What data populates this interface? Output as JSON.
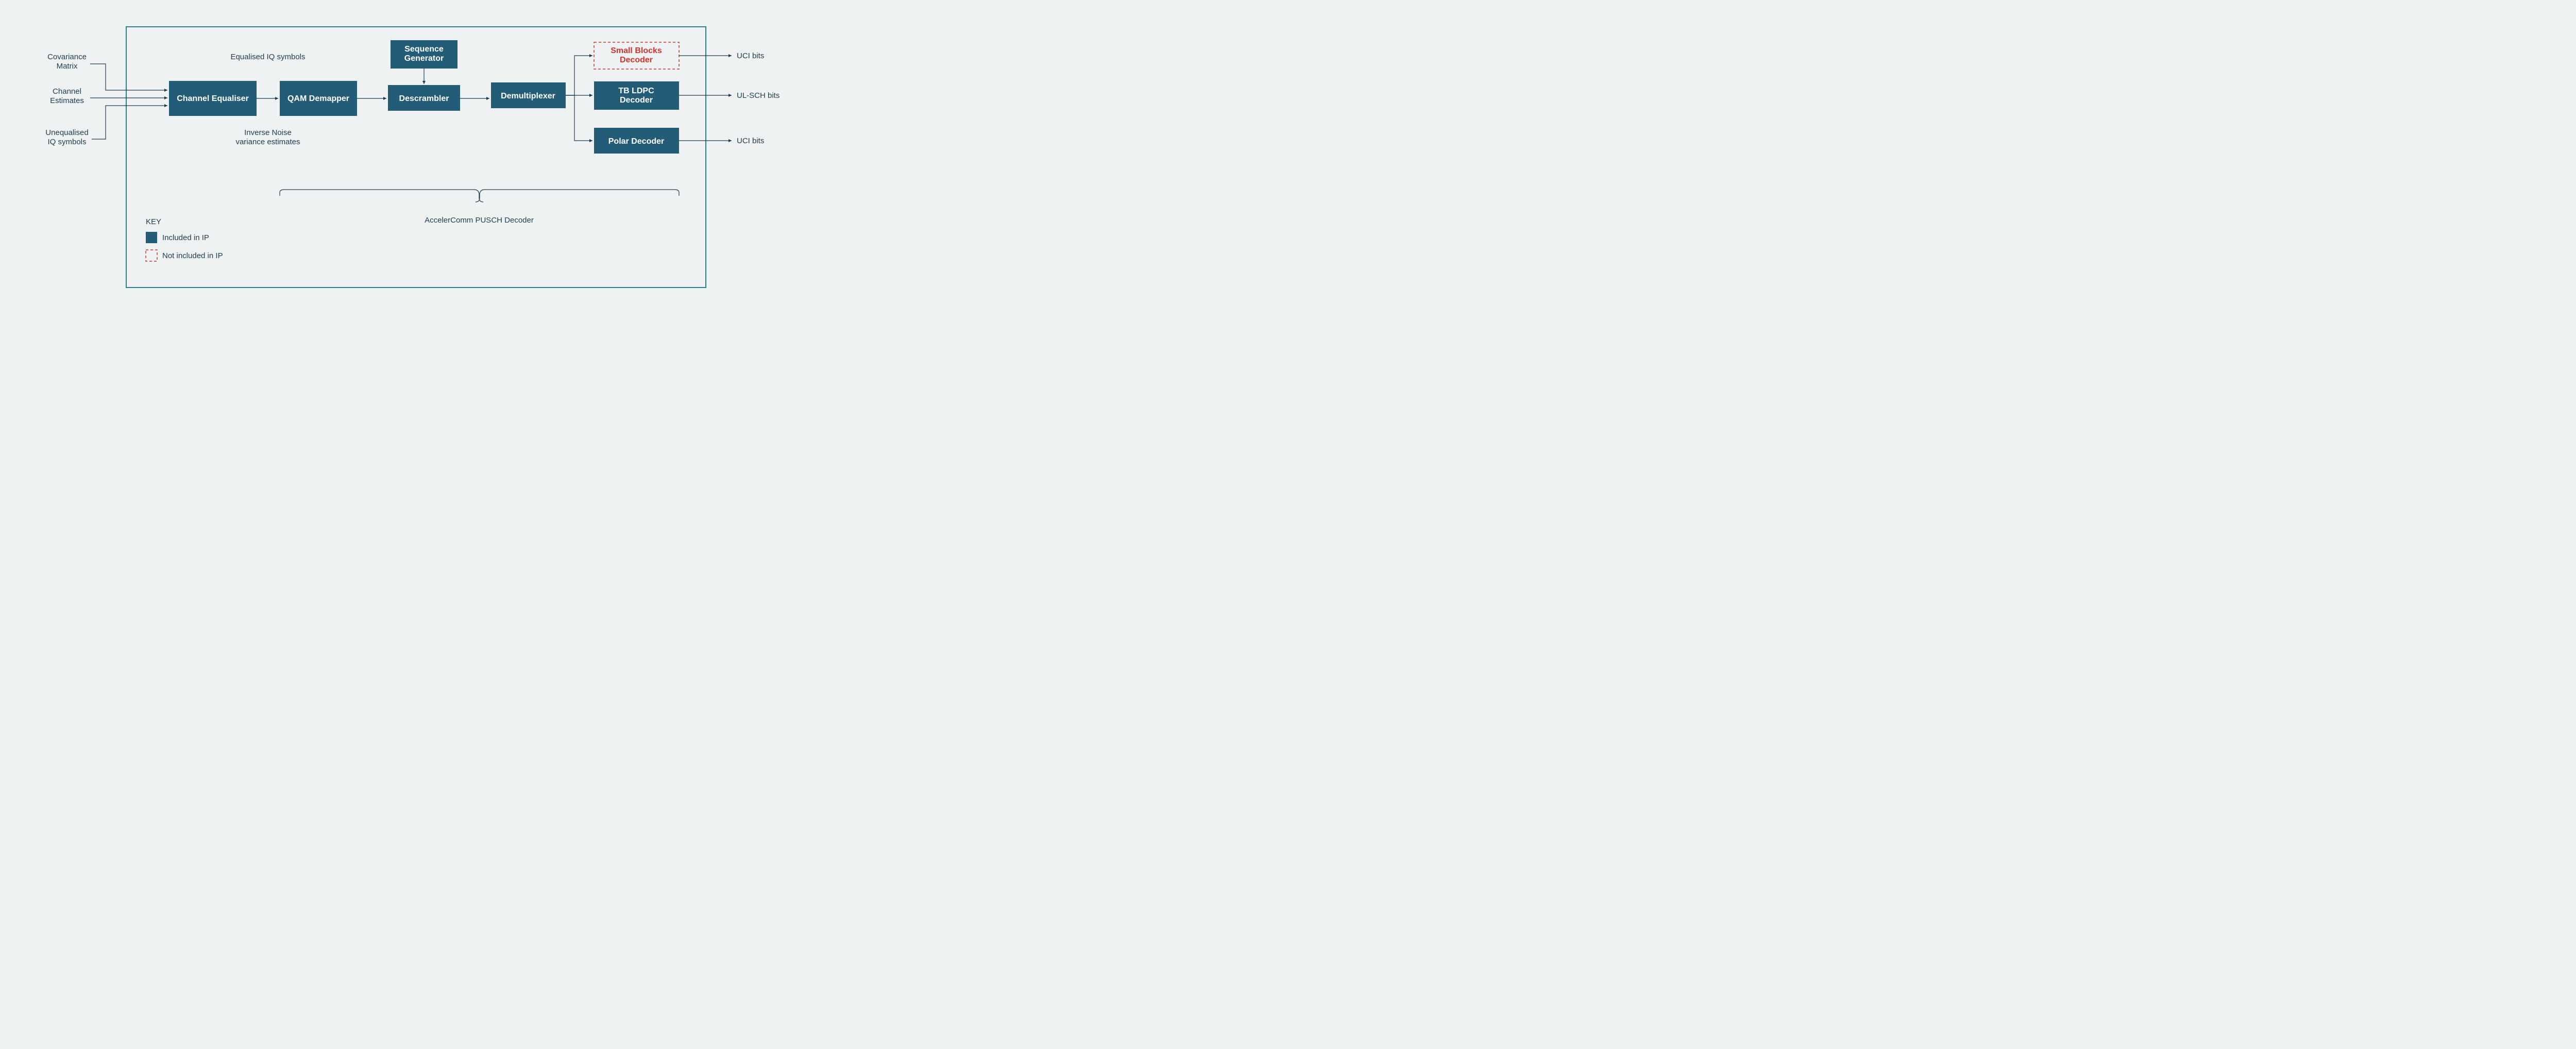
{
  "inputs": {
    "covariance": "Covariance\nMatrix",
    "channel_est": "Channel\nEstimates",
    "unequalised": "Unequalised\nIQ symbols"
  },
  "blocks": {
    "equaliser": "Channel Equaliser",
    "demapper": "QAM Demapper",
    "seqgen": "Sequence\nGenerator",
    "descrambler": "Descrambler",
    "demux": "Demultiplexer",
    "small_blocks": "Small Blocks\nDecoder",
    "ldpc": "TB LDPC\nDecoder",
    "polar": "Polar Decoder"
  },
  "annotations": {
    "eq_iq": "Equalised IQ symbols",
    "inv_noise": "Inverse Noise\nvariance estimates",
    "brace_label": "AccelerComm PUSCH Decoder"
  },
  "outputs": {
    "uci_top": "UCI bits",
    "ulsch": "UL-SCH bits",
    "uci_bot": "UCI bits"
  },
  "key": {
    "title": "KEY",
    "included": "Included in IP",
    "not_included": "Not included in IP"
  },
  "colors": {
    "block": "#225c77",
    "frame": "#2a7f8a",
    "red": "#d3332b",
    "text": "#1f3b4d",
    "bg": "#eef2f3"
  }
}
